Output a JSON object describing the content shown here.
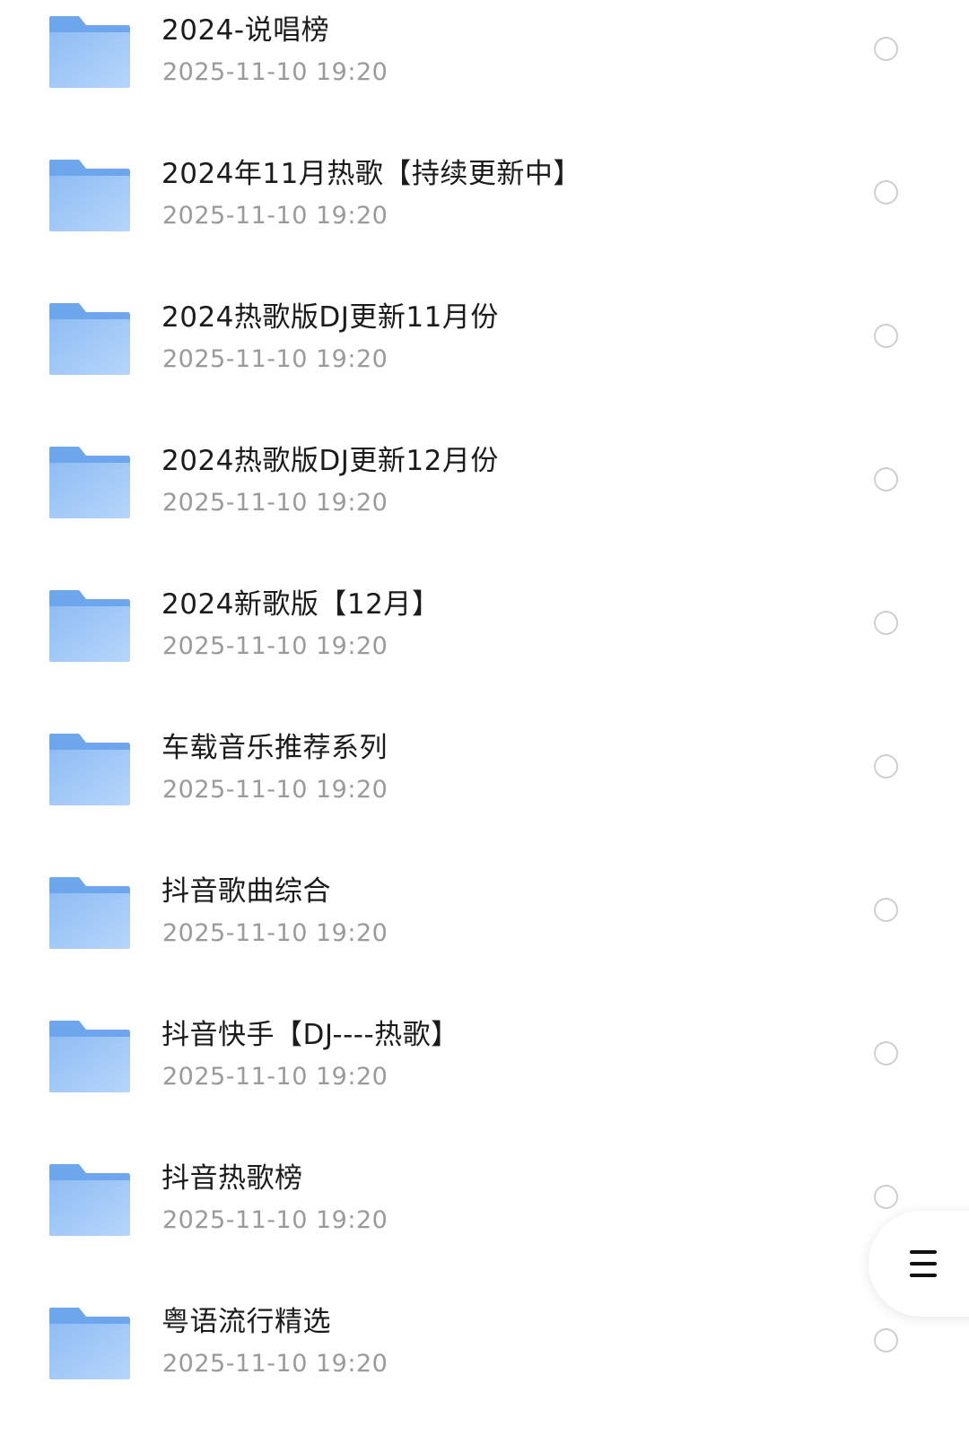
{
  "colors": {
    "folder_front_top": "#8fbdf4",
    "folder_front_bottom": "#b6d6fb",
    "folder_back": "#6da6ec",
    "title_text": "#1b1b1b",
    "date_text": "#9a9a9a",
    "radio_border": "#cfcfcf"
  },
  "icons": {
    "folder": "folder-icon",
    "select": "radio-circle-icon",
    "menu": "hamburger-menu-icon"
  },
  "items": [
    {
      "name": "2024-说唱榜",
      "date": "2025-11-10 19:20"
    },
    {
      "name": "2024年11月热歌【持续更新中】",
      "date": "2025-11-10 19:20"
    },
    {
      "name": "2024热歌版DJ更新11月份",
      "date": "2025-11-10 19:20"
    },
    {
      "name": "2024热歌版DJ更新12月份",
      "date": "2025-11-10 19:20"
    },
    {
      "name": "2024新歌版【12月】",
      "date": "2025-11-10 19:20"
    },
    {
      "name": "车载音乐推荐系列",
      "date": "2025-11-10 19:20"
    },
    {
      "name": "抖音歌曲综合",
      "date": "2025-11-10 19:20"
    },
    {
      "name": "抖音快手【DJ----热歌】",
      "date": "2025-11-10 19:20"
    },
    {
      "name": "抖音热歌榜",
      "date": "2025-11-10 19:20"
    },
    {
      "name": "粤语流行精选",
      "date": "2025-11-10 19:20"
    }
  ]
}
